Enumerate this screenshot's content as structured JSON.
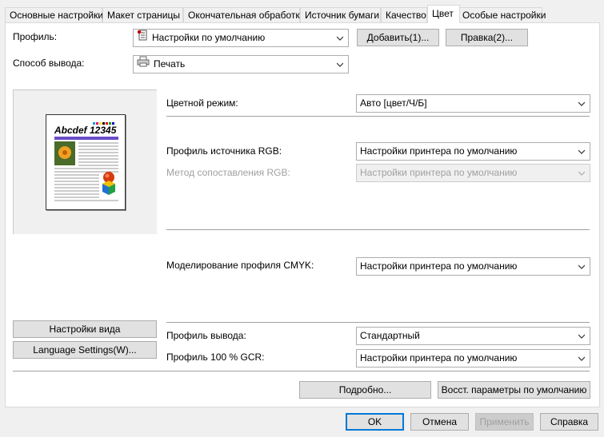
{
  "tabs": [
    {
      "label": "Основные настройки"
    },
    {
      "label": "Макет страницы"
    },
    {
      "label": "Окончательная обработка"
    },
    {
      "label": "Источник бумаги"
    },
    {
      "label": "Качество"
    },
    {
      "label": "Цвет"
    },
    {
      "label": "Особые настройки"
    }
  ],
  "profile": {
    "label": "Профиль:",
    "value": "Настройки по умолчанию",
    "add_button": "Добавить(1)...",
    "edit_button": "Правка(2)..."
  },
  "output_method": {
    "label": "Способ вывода:",
    "value": "Печать"
  },
  "preview": {
    "sample_title": "Abcdef 12345",
    "view_settings_button": "Настройки вида",
    "language_button": "Language Settings(W)..."
  },
  "color": {
    "color_mode_label": "Цветной режим:",
    "color_mode_value": "Авто [цвет/Ч/Б]",
    "rgb_source_label": "Профиль источника RGB:",
    "rgb_source_value": "Настройки принтера по умолчанию",
    "rgb_matching_label": "Метод сопоставления RGB:",
    "rgb_matching_value": "Настройки принтера по умолчанию",
    "cmyk_sim_label": "Моделирование профиля CMYK:",
    "cmyk_sim_value": "Настройки принтера по умолчанию",
    "output_profile_label": "Профиль вывода:",
    "output_profile_value": "Стандартный",
    "gcr_label": "Профиль 100 % GCR:",
    "gcr_value": "Настройки принтера по умолчанию"
  },
  "footer": {
    "details_button": "Подробно...",
    "restore_button": "Восст. параметры по умолчанию",
    "ok": "OK",
    "cancel": "Отмена",
    "apply": "Применить",
    "help": "Справка"
  }
}
